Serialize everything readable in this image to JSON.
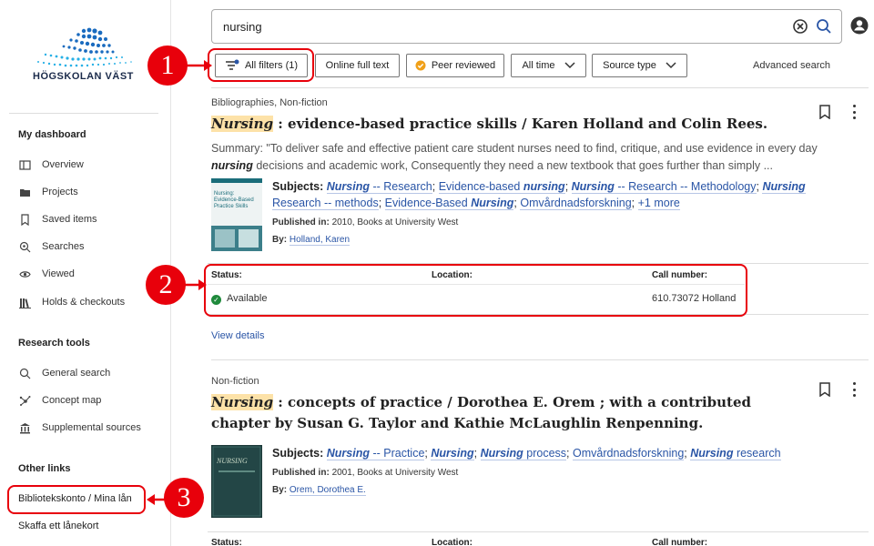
{
  "logo": {
    "text": "HÖGSKOLAN VÄST",
    "primary_color": "#1a6bbf",
    "secondary_color": "#27b0e6"
  },
  "search": {
    "value": "nursing",
    "clear_icon": "clear-circle-icon",
    "search_icon": "search-icon"
  },
  "user": {
    "icon": "user-account-icon"
  },
  "filters": {
    "all_filters": "All filters (1)",
    "online_full_text": "Online full text",
    "peer_reviewed": "Peer reviewed",
    "all_time": "All time",
    "source_type": "Source type",
    "advanced_search": "Advanced search"
  },
  "sidebar": {
    "dashboard_heading": "My dashboard",
    "dashboard_items": [
      {
        "label": "Overview",
        "icon": "overview-icon"
      },
      {
        "label": "Projects",
        "icon": "projects-icon"
      },
      {
        "label": "Saved items",
        "icon": "bookmark-icon"
      },
      {
        "label": "Searches",
        "icon": "searches-icon"
      },
      {
        "label": "Viewed",
        "icon": "eye-icon"
      },
      {
        "label": "Holds & checkouts",
        "icon": "books-icon"
      }
    ],
    "research_heading": "Research tools",
    "research_items": [
      {
        "label": "General search",
        "icon": "search-icon"
      },
      {
        "label": "Concept map",
        "icon": "concept-map-icon"
      },
      {
        "label": "Supplemental sources",
        "icon": "library-icon"
      }
    ],
    "other_heading": "Other links",
    "other_links": [
      "Bibliotekskonto / Mina lån",
      "Skaffa ett lånekort"
    ]
  },
  "results": [
    {
      "type": "Bibliographies, Non-fiction",
      "title_highlight": "Nursing",
      "title_rest": " : evidence-based practice skills / Karen Holland and Colin Rees.",
      "summary_prefix": "Summary: \"To deliver safe and effective patient care student nurses need to find, critique, and use evidence in every day ",
      "summary_highlight": "nursing",
      "summary_suffix": " decisions and academic work, Consequently they need a new textbook that goes further than simply ...",
      "subjects_label": "Subjects:",
      "published_label": "Published in:",
      "published_value": "2010, Books at University West",
      "by_label": "By:",
      "author": "Holland, Karen",
      "status_label": "Status:",
      "location_label": "Location:",
      "call_label": "Call number:",
      "status_value": "Available",
      "call_value": "610.73072 Holland",
      "view_details": "View details"
    },
    {
      "type": "Non-fiction",
      "title_highlight": "Nursing",
      "title_rest": " : concepts of practice / Dorothea E. Orem ; with a contributed chapter by Susan G. Taylor and Kathie McLaughlin Renpenning.",
      "subjects_label": "Subjects:",
      "published_label": "Published in:",
      "published_value": "2001, Books at University West",
      "by_label": "By:",
      "author": "Orem, Dorothea E.",
      "status_label": "Status:",
      "location_label": "Location:",
      "call_label": "Call number:"
    }
  ],
  "subjects1": {
    "s1_em": "Nursing",
    "s1_rest": " -- Research",
    "s2_pre": "Evidence-based ",
    "s2_em": "nursing",
    "s3_em": "Nursing",
    "s3_rest": " -- Research -- Methodology",
    "s4_em": "Nursing",
    "s4_rest": "Research -- methods",
    "s5_pre": "Evidence-Based ",
    "s5_em": "Nursing",
    "s6": "Omvårdnadsforskning",
    "more": "+1 more"
  },
  "subjects2": {
    "s1_em": "Nursing",
    "s1_rest": " -- Practice",
    "s2_em": "Nursing",
    "s3_em": "Nursing",
    "s3_rest": " process",
    "s4": "Omvårdnadsforskning",
    "s5_em": "Nursing",
    "s5_rest": " research"
  },
  "cover1": {
    "lines": [
      "Nursing:",
      "Evidence-Based",
      "Practice Skills"
    ]
  },
  "cover2": {
    "text": "NURSING"
  },
  "annotations": [
    "1",
    "2",
    "3"
  ],
  "colors": {
    "annotation": "#e8000b",
    "link": "#2a55a6",
    "highlight": "#fde2a8",
    "available": "#1f8a3c"
  }
}
